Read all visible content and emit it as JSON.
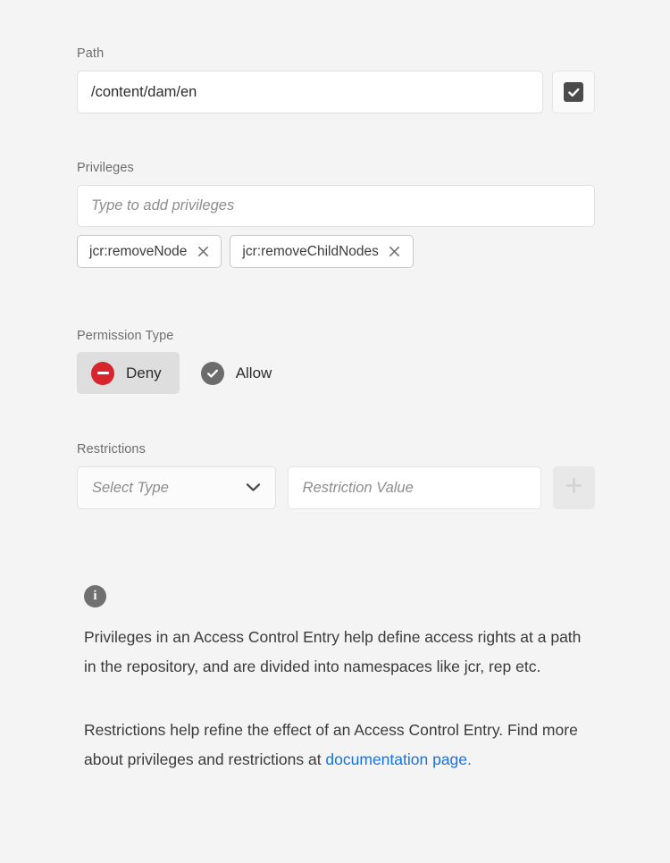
{
  "path": {
    "label": "Path",
    "value": "/content/dam/en",
    "checkbox_icon": "checkbox-checked-icon",
    "checkbox_checked": true
  },
  "privileges": {
    "label": "Privileges",
    "placeholder": "Type to add privileges",
    "input_value": "",
    "tags": [
      {
        "label": "jcr:removeNode",
        "remove_icon": "close-icon"
      },
      {
        "label": "jcr:removeChildNodes",
        "remove_icon": "close-icon"
      }
    ]
  },
  "permission_type": {
    "label": "Permission Type",
    "selected": "Deny",
    "options": [
      {
        "label": "Deny",
        "icon": "deny-circle-icon",
        "color": "#d7252e",
        "selected": true
      },
      {
        "label": "Allow",
        "icon": "check-circle-icon",
        "color": "#6c6c6c",
        "selected": false
      }
    ]
  },
  "restrictions": {
    "label": "Restrictions",
    "select_type_placeholder": "Select Type",
    "select_type_value": "",
    "dropdown_icon": "chevron-down-icon",
    "value_placeholder": "Restriction Value",
    "value": "",
    "add_button_icon": "plus-icon",
    "add_button_disabled": true
  },
  "info": {
    "icon": "info-icon",
    "paragraph_one": "Privileges in an Access Control Entry help define access rights at a path in the repository, and are divided into namespaces like jcr, rep etc.",
    "paragraph_two_prefix": "Restrictions help refine the effect of an Access Control Entry. Find more about privileges and restrictions at ",
    "link_text": "documentation page.",
    "link_color": "#1473e6"
  },
  "theme": {
    "background": "#f4f4f4",
    "label_color": "#6e6e6e",
    "text_color": "#2c2c2c",
    "placeholder_color": "#8d8d8d"
  }
}
